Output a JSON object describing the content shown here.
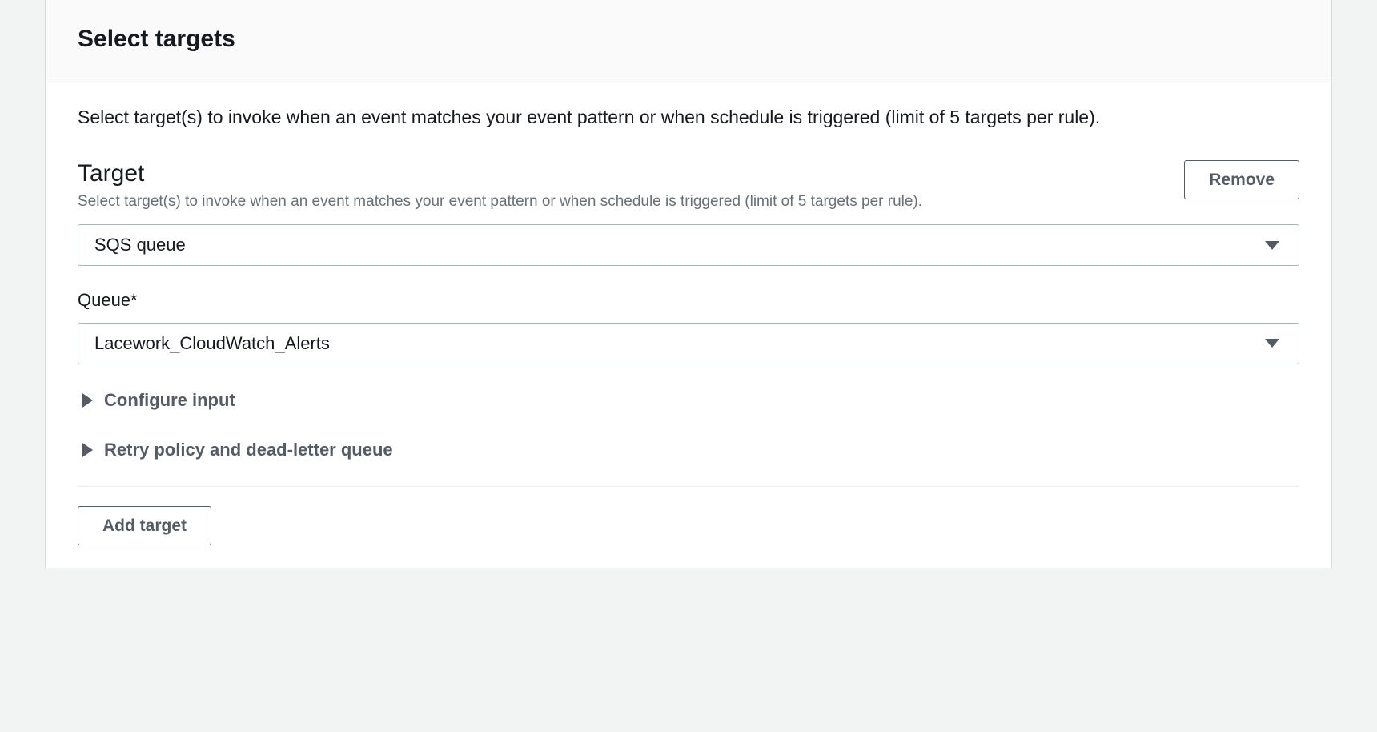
{
  "header": {
    "title": "Select targets"
  },
  "description": "Select target(s) to invoke when an event matches your event pattern or when schedule is triggered (limit of 5 targets per rule).",
  "target": {
    "title": "Target",
    "subdesc": "Select target(s) to invoke when an event matches your event pattern or when schedule is triggered (limit of 5 targets per rule).",
    "remove_label": "Remove",
    "type_select": {
      "selected": "SQS queue"
    },
    "queue_label": "Queue*",
    "queue_select": {
      "selected": "Lacework_CloudWatch_Alerts"
    },
    "expanders": {
      "configure_input": "Configure input",
      "retry_policy": "Retry policy and dead-letter queue"
    }
  },
  "add_target_label": "Add target"
}
